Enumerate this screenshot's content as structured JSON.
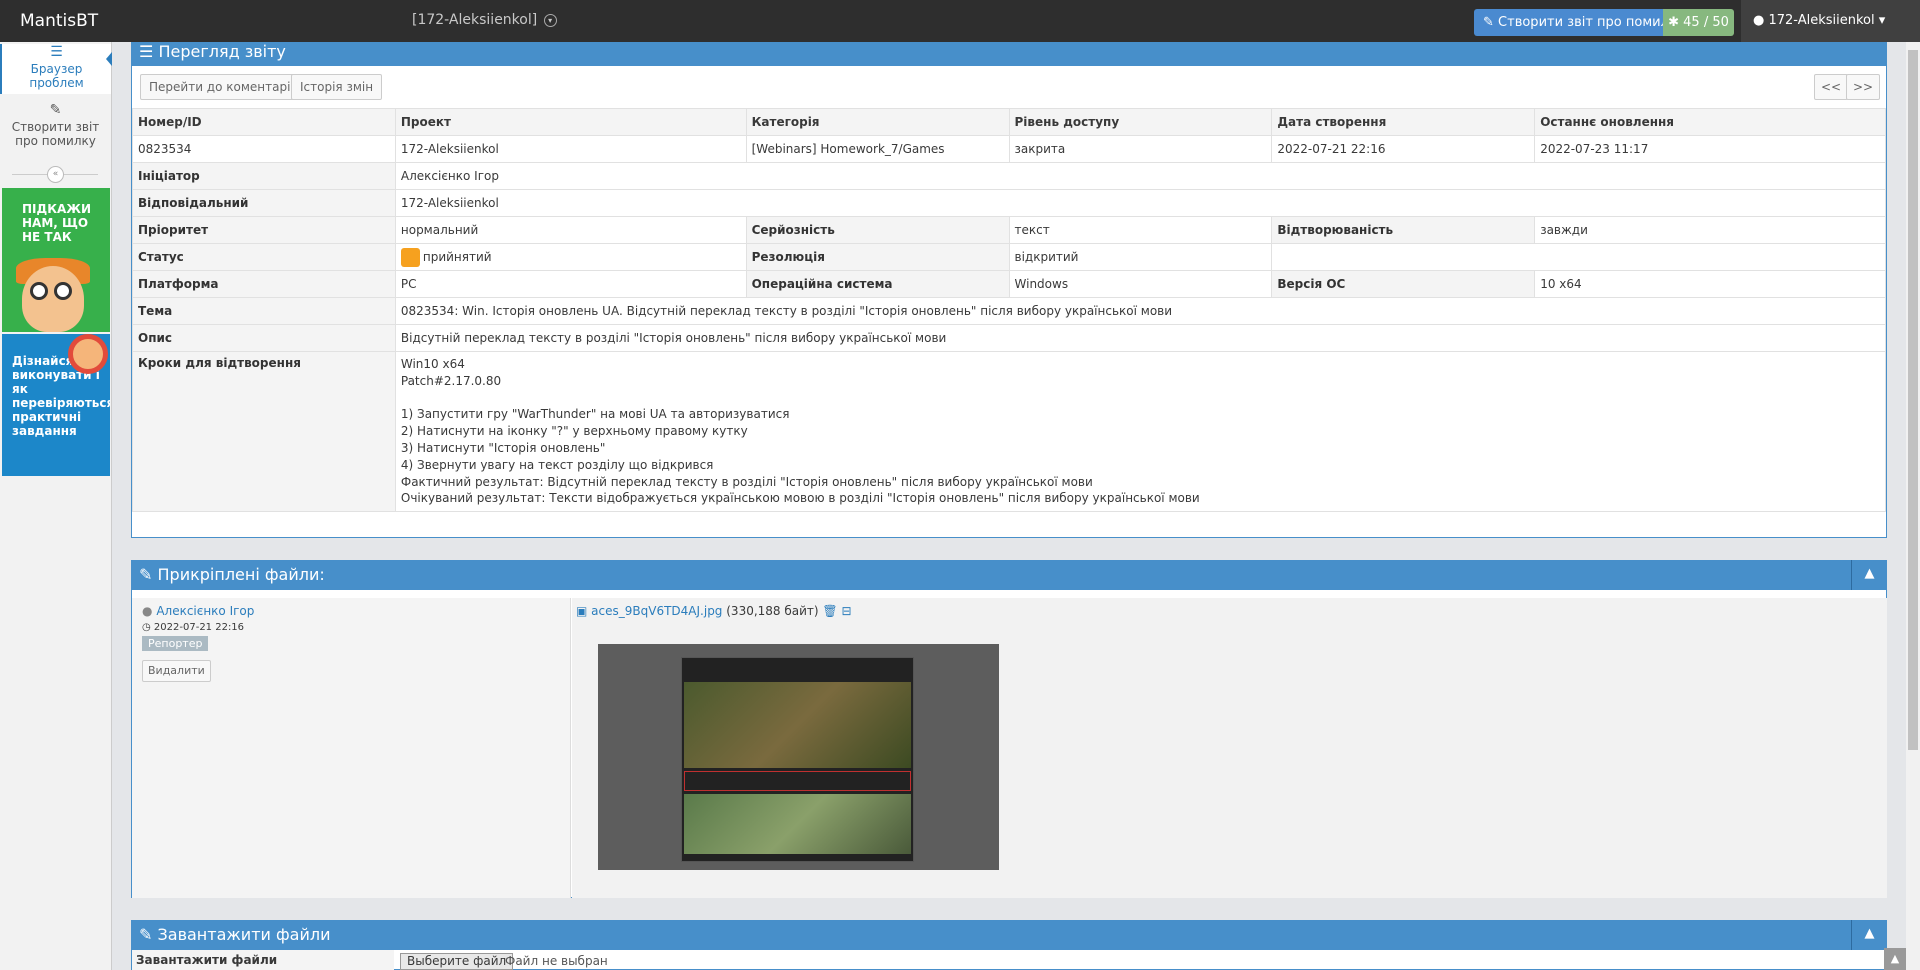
{
  "navbar": {
    "brand": "MantisBT",
    "project": "[172-Aleksiienkol]",
    "report_button": "Створити звіт про помилку",
    "issue_count": "45 / 50",
    "user": "172-Aleksiienkol"
  },
  "sidebar": {
    "browse": "Браузер проблем",
    "create": "Створити звіт про помилку",
    "ad1": "ПІДКАЖИ НАМ, ЩО НЕ ТАК",
    "ad2": "Дізнайся як виконувати і як перевіряються практичні завдання"
  },
  "view": {
    "title": "Перегляд звіту",
    "btn_comments": "Перейти до коментарів",
    "btn_history": "Історія змін",
    "btn_prev": "<<",
    "btn_next": ">>"
  },
  "details": {
    "columns": [
      "Номер/ID",
      "Проект",
      "Категорія",
      "Рівень доступу",
      "Дата створення",
      "Останнє оновлення"
    ],
    "values": [
      "0823534",
      "172-Aleksiienkol",
      "[Webinars] Homework_7/Games",
      "закрита",
      "2022-07-21 22:16",
      "2022-07-23 11:17"
    ],
    "reporter_label": "Ініціатор",
    "reporter": "Алексієнко Ігор",
    "assigned_label": "Відповідальний",
    "assigned": "172-Aleksiienkol",
    "priority_label": "Пріоритет",
    "priority": "нормальний",
    "severity_label": "Серйозність",
    "severity": "текст",
    "reproducibility_label": "Відтворюваність",
    "reproducibility": "завжди",
    "status_label": "Статус",
    "status": "прийнятий",
    "status_color": "#f6a11f",
    "resolution_label": "Резолюція",
    "resolution": "відкритий",
    "platform_label": "Платформа",
    "platform": "PC",
    "os_label": "Операційна система",
    "os": "Windows",
    "os_version_label": "Версія ОС",
    "os_version": "10 x64",
    "summary_label": "Тема",
    "summary": "0823534: Win. Історія оновлень UA. Відсутній переклад тексту в розділі \"Історія оновлень\" після вибору української мови",
    "description_label": "Опис",
    "description": "Відсутній переклад тексту в розділі \"Історія оновлень\" після вибору української мови",
    "steps_label": "Кроки для відтворення",
    "steps": [
      "Win10 x64",
      "Patch#2.17.0.80",
      "",
      "1) Запустити гру \"WarThunder\" на мові UA та авторизуватися",
      "2) Натиснути на іконку \"?\" у верхньому правому кутку",
      "3) Натиснути \"Історія оновлень\"",
      "4) Звернути увагу на текст розділу що відкрився",
      "Фактичний результат: Відсутній переклад тексту в розділі \"Історія оновлень\" після вибору української мови",
      "Очікуваний результат: Тексти відображується українською мовою в розділі \"Історія оновлень\" після вибору української мови"
    ]
  },
  "attachments": {
    "title": "Прикріплені файли:",
    "author": "Алексієнко Ігор",
    "date": "2022-07-21 22:16",
    "role": "Репортер",
    "delete_btn": "Видалити",
    "file_name": "aces_9BqV6TD4AJ.jpg",
    "file_size": "(330,188 байт)"
  },
  "upload": {
    "title": "Завантажити файли",
    "label": "Завантажити файли",
    "choose_btn": "Выберите файл",
    "no_file": "Файл не выбран"
  }
}
